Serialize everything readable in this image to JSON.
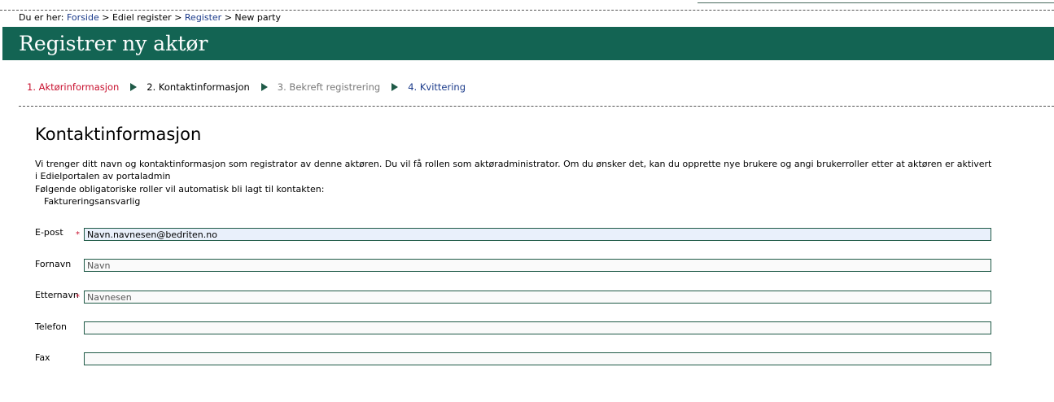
{
  "breadcrumb": {
    "prefix": "Du er her:",
    "items": [
      {
        "label": "Forside",
        "link": true
      },
      {
        "label": "Ediel register",
        "link": false
      },
      {
        "label": "Register",
        "link": true
      },
      {
        "label": "New party",
        "link": false
      }
    ],
    "separator": ">"
  },
  "banner": {
    "title": "Registrer ny aktør",
    "color": "#136453"
  },
  "steps": [
    {
      "label": "1. Aktørinformasjon",
      "color": "#c8102e"
    },
    {
      "label": "2. Kontaktinformasjon",
      "color": "#000000"
    },
    {
      "label": "3. Bekreft registrering",
      "color": "#7a7a7a"
    },
    {
      "label": "4. Kvittering",
      "color": "#1a3a8a"
    }
  ],
  "section": {
    "title": "Kontaktinformasjon",
    "description": "Vi trenger ditt navn og kontaktinformasjon som registrator av denne aktøren. Du vil få rollen som aktøradministrator. Om du ønsker det, kan du opprette nye brukere og angi brukerroller etter at aktøren er aktivert i Edielportalen av portaladmin",
    "roles_intro": "Følgende obligatoriske roller vil automatisk bli lagt til kontakten:",
    "roles": [
      "Faktureringsansvarlig"
    ]
  },
  "form": {
    "email": {
      "label": "E-post",
      "required": true,
      "value": "Navn.navnesen@bedriten.no"
    },
    "first_name": {
      "label": "Fornavn",
      "required": false,
      "value": "Navn"
    },
    "last_name": {
      "label": "Etternavn",
      "required": true,
      "value": "Navnesen"
    },
    "phone": {
      "label": "Telefon",
      "required": false,
      "value": ""
    },
    "fax": {
      "label": "Fax",
      "required": false,
      "value": ""
    }
  },
  "required_marker": "*"
}
